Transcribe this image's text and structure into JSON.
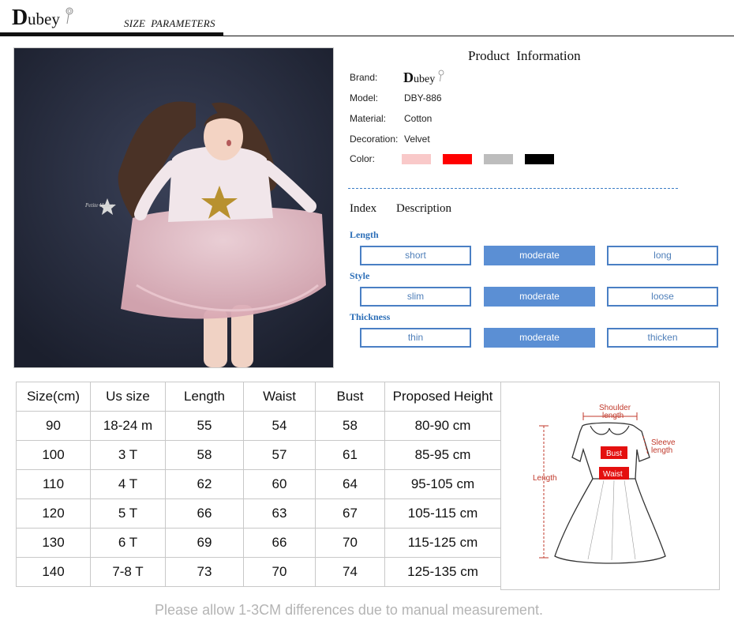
{
  "header": {
    "brand": "Dubey",
    "section_title": "SIZE  PARAMETERS"
  },
  "product_info": {
    "title": "Product  Information",
    "brand_label": "Brand:",
    "model_label": "Model:",
    "model_value": "DBY-886",
    "material_label": "Material:",
    "material_value": "Cotton",
    "decoration_label": "Decoration:",
    "decoration_value": "Velvet",
    "color_label": "Color:",
    "colors": [
      "#f9c9c9",
      "#ff0000",
      "#bdbdbd",
      "#000000"
    ]
  },
  "index": {
    "heading_index": "Index",
    "heading_description": "Description",
    "categories": [
      {
        "label": "Length",
        "options": [
          "short",
          "moderate",
          "long"
        ],
        "selected": 1
      },
      {
        "label": "Style",
        "options": [
          "slim",
          "moderate",
          "loose"
        ],
        "selected": 1
      },
      {
        "label": "Thickness",
        "options": [
          "thin",
          "moderate",
          "thicken"
        ],
        "selected": 1
      }
    ]
  },
  "size_table": {
    "headers": [
      "Size(cm)",
      "Us size",
      "Length",
      "Waist",
      "Bust",
      "Proposed Height"
    ],
    "rows": [
      [
        "90",
        "18-24 m",
        "55",
        "54",
        "58",
        "80-90 cm"
      ],
      [
        "100",
        "3 T",
        "58",
        "57",
        "61",
        "85-95 cm"
      ],
      [
        "110",
        "4 T",
        "62",
        "60",
        "64",
        "95-105 cm"
      ],
      [
        "120",
        "5 T",
        "66",
        "63",
        "67",
        "105-115 cm"
      ],
      [
        "130",
        "6 T",
        "69",
        "66",
        "70",
        "115-125 cm"
      ],
      [
        "140",
        "7-8 T",
        "73",
        "70",
        "74",
        "125-135 cm"
      ]
    ]
  },
  "diagram": {
    "shoulder_label": "Shoulder",
    "shoulder_label2": "length",
    "sleeve_label": "Sleeve",
    "sleeve_label2": "length",
    "length_label": "Length",
    "bust_label": "Bust",
    "waist_label": "Waist"
  },
  "photo": {
    "shirt_text": "Petite  Hailey"
  },
  "note": "Please allow 1-3CM differences due to manual measurement."
}
